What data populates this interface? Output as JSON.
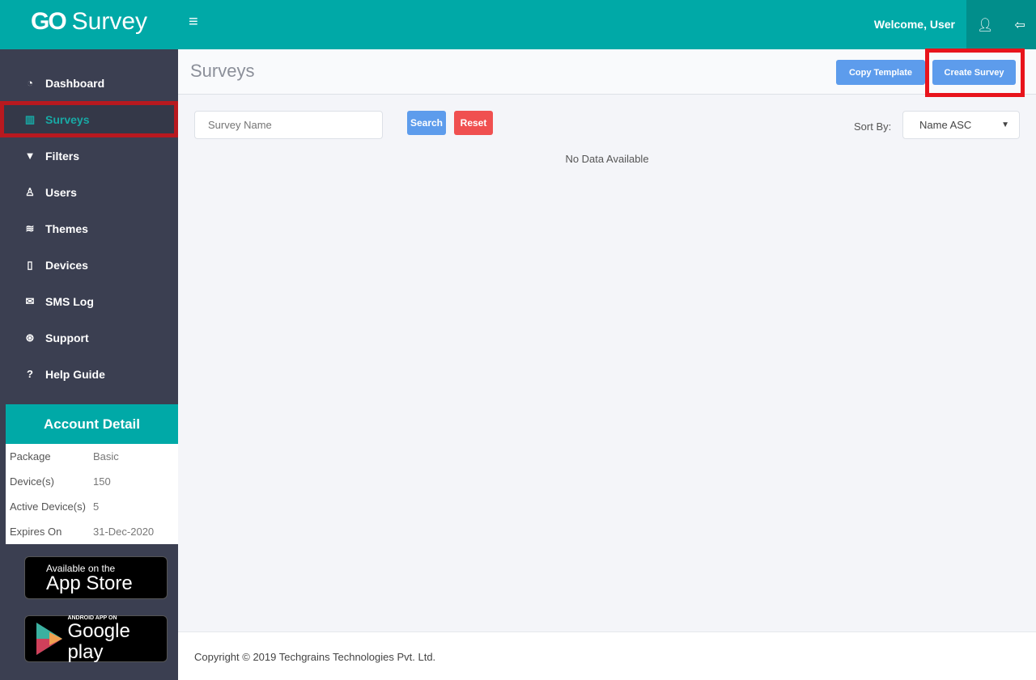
{
  "brand": {
    "logo_mark": "GO",
    "name": "Survey"
  },
  "header": {
    "menu_icon": "hamburger-icon",
    "welcome": "Welcome, User",
    "user_icon": "user-icon",
    "logout_icon": "logout-icon"
  },
  "sidebar": {
    "items": [
      {
        "label": "Dashboard",
        "icon": "dashboard-icon",
        "glyph": "◔"
      },
      {
        "label": "Surveys",
        "icon": "book-icon",
        "glyph": "▥",
        "active": true
      },
      {
        "label": "Filters",
        "icon": "filter-icon",
        "glyph": "▼"
      },
      {
        "label": "Users",
        "icon": "user-icon",
        "glyph": "♙"
      },
      {
        "label": "Themes",
        "icon": "layers-icon",
        "glyph": "≋"
      },
      {
        "label": "Devices",
        "icon": "tablet-icon",
        "glyph": "▯"
      },
      {
        "label": "SMS Log",
        "icon": "chat-icon",
        "glyph": "✉"
      },
      {
        "label": "Support",
        "icon": "lifebuoy-icon",
        "glyph": "⊛"
      },
      {
        "label": "Help Guide",
        "icon": "question-icon",
        "glyph": "?"
      }
    ]
  },
  "account": {
    "title": "Account Detail",
    "rows": [
      {
        "label": "Package",
        "value": "Basic"
      },
      {
        "label": "Device(s)",
        "value": "150"
      },
      {
        "label": "Active Device(s)",
        "value": "5"
      },
      {
        "label": "Expires On",
        "value": "31-Dec-2020"
      }
    ]
  },
  "stores": {
    "apple_small": "Available on the",
    "apple_big": "App Store",
    "google_small": "ANDROID APP ON",
    "google_big": "Google play"
  },
  "page": {
    "title": "Surveys",
    "copy_template": "Copy Template",
    "create_survey": "Create Survey"
  },
  "filters": {
    "search_placeholder": "Survey Name",
    "search": "Search",
    "reset": "Reset",
    "sort_label": "Sort By:",
    "sort_value": "Name ASC"
  },
  "content": {
    "empty": "No Data Available"
  },
  "footer": {
    "copyright": "Copyright © 2019 Techgrains Technologies Pvt. Ltd."
  },
  "colors": {
    "primary": "#00a9a7",
    "sidebar": "#3b3f51",
    "button_blue": "#5d9cec",
    "button_red": "#f05050",
    "highlight": "#e8141c"
  }
}
